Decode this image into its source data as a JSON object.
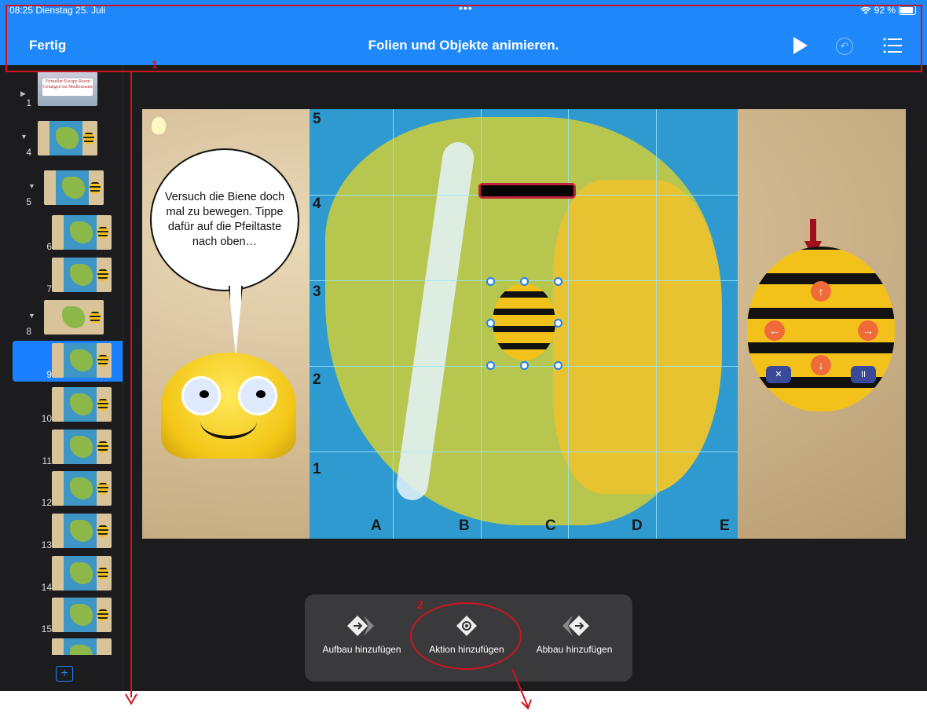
{
  "status_bar": {
    "time_date": "08:25  Dienstag 25. Juli",
    "dots": "•••",
    "battery": "92 %"
  },
  "header": {
    "done_label": "Fertig",
    "title": "Folien und Objekte animieren."
  },
  "slides": [
    {
      "number": "1",
      "title": "Virtueller Escape Room",
      "subtitle": "Gefangen im Medienraum"
    },
    {
      "number": "4"
    },
    {
      "number": "5"
    },
    {
      "number": "6"
    },
    {
      "number": "7"
    },
    {
      "number": "8"
    },
    {
      "number": "9"
    },
    {
      "number": "10"
    },
    {
      "number": "11"
    },
    {
      "number": "12"
    },
    {
      "number": "13"
    },
    {
      "number": "14"
    },
    {
      "number": "15"
    }
  ],
  "slide_content": {
    "speech_bubble": "Versuch die Biene doch mal zu bewegen. Tippe dafür auf die Pfeiltaste nach oben…",
    "grid_rows": [
      "5",
      "4",
      "3",
      "2",
      "1"
    ],
    "grid_cols": [
      "A",
      "B",
      "C",
      "D",
      "E"
    ]
  },
  "popover": {
    "build_in_label": "Aufbau hinzufügen",
    "action_label": "Aktion hinzufügen",
    "build_out_label": "Abbau hinzufügen"
  },
  "annotations": {
    "marker_1": "1",
    "marker_2": "2",
    "accent_color": "#d0131f"
  },
  "colors": {
    "header_blue": "#1e88fb",
    "selection_blue": "#1a80ff",
    "background": "#1c1c1e"
  }
}
